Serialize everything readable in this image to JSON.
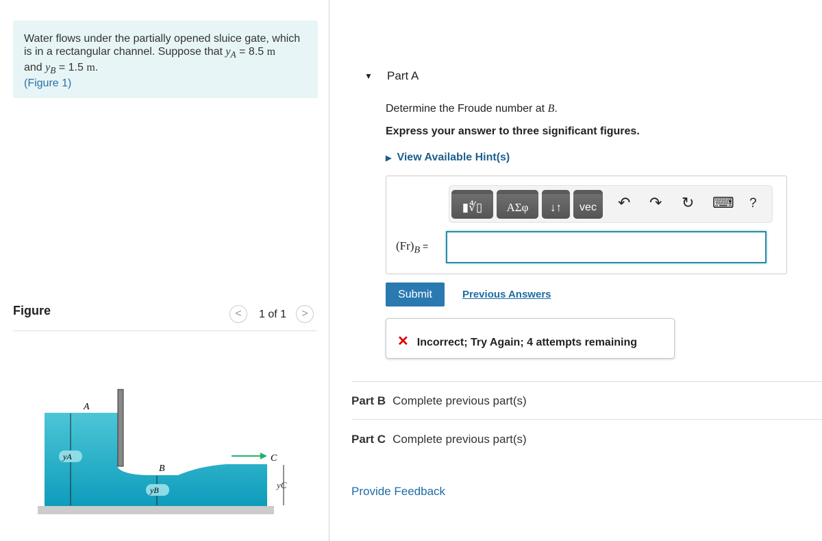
{
  "problem": {
    "text1": "Water flows under the partially opened sluice gate, which is in a rectangular channel. Suppose that ",
    "yA_sym": "y",
    "yA_sub": "A",
    "yA_val": " = 8.5 ",
    "unit": "m",
    "and": "and ",
    "yB_sym": "y",
    "yB_sub": "B",
    "yB_val": " = 1.5 ",
    "period": ".",
    "figure_link": "(Figure 1)"
  },
  "figure": {
    "title": "Figure",
    "counter": "1 of 1",
    "prev": "<",
    "next": ">",
    "labels": {
      "A": "A",
      "B": "B",
      "C": "C",
      "yA": "yA",
      "yB": "yB",
      "yC": "yC"
    }
  },
  "partA": {
    "title": "Part A",
    "question": "Determine the Froude number at ",
    "question_var": "B",
    "question_end": ".",
    "instruction": "Express your answer to three significant figures.",
    "hint": "View Available Hint(s)",
    "toolbar": {
      "templates": "▮∜▯",
      "greek": "ΑΣφ",
      "arrows": "↓↑",
      "vec": "vec",
      "undo": "↶",
      "redo": "↷",
      "reset": "↻",
      "keyboard": "⌨",
      "help": "?"
    },
    "label": "(Fr)",
    "label_sub": "B",
    "eq": " =",
    "input_value": "",
    "submit": "Submit",
    "previous": "Previous Answers",
    "feedback": {
      "icon": "✕",
      "text": "Incorrect; Try Again; 4 attempts remaining",
      "color": "#dd0000"
    }
  },
  "partB": {
    "title": "Part B",
    "status": "Complete previous part(s)"
  },
  "partC": {
    "title": "Part C",
    "status": "Complete previous part(s)"
  },
  "provide_feedback": "Provide Feedback"
}
